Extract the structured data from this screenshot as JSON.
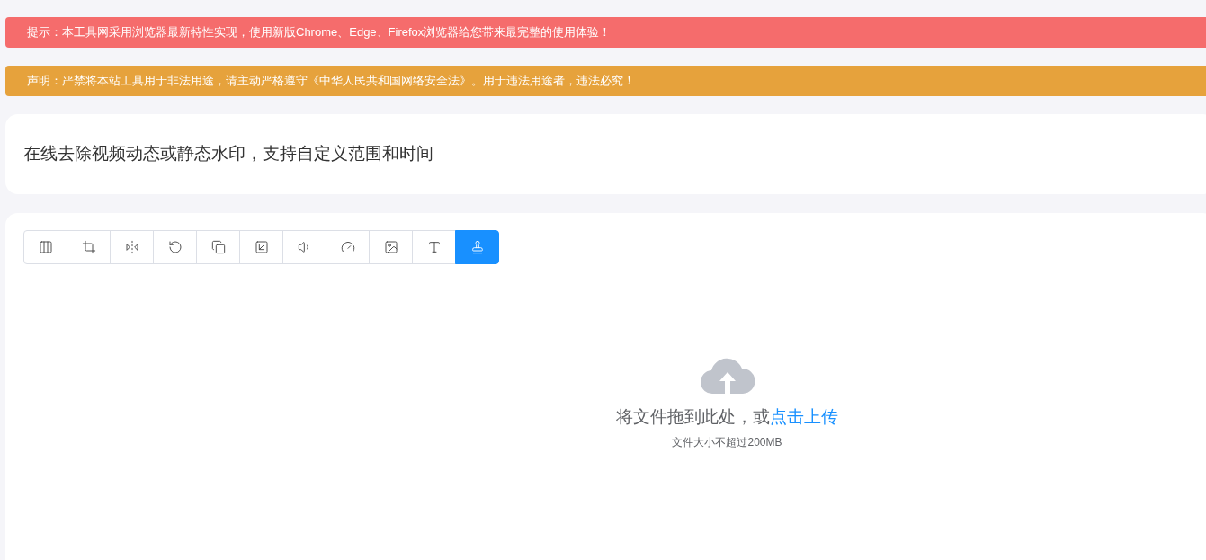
{
  "notices": [
    {
      "kind": "tip",
      "text": "提示：本工具网采用浏览器最新特性实现，使用新版Chrome、Edge、Firefox浏览器给您带来最完整的使用体验！"
    },
    {
      "kind": "warning",
      "text": "声明：严禁将本站工具用于非法用途，请主动严格遵守《中华人民共和国网络安全法》。用于违法用途者，违法必究！"
    }
  ],
  "description": "在线去除视频动态或静态水印，支持自定义范围和时间",
  "toolbar": [
    {
      "kind": "split",
      "selected": false
    },
    {
      "kind": "crop",
      "selected": false
    },
    {
      "kind": "flip",
      "selected": false
    },
    {
      "kind": "rotate",
      "selected": false
    },
    {
      "kind": "layers",
      "selected": false
    },
    {
      "kind": "resize",
      "selected": false
    },
    {
      "kind": "volume",
      "selected": false
    },
    {
      "kind": "speed",
      "selected": false
    },
    {
      "kind": "image",
      "selected": false
    },
    {
      "kind": "text",
      "selected": false
    },
    {
      "kind": "stamp",
      "selected": true
    }
  ],
  "upload": {
    "prompt": "将文件拖到此处，或",
    "link": "点击上传",
    "note": "文件大小不超过200MB"
  }
}
